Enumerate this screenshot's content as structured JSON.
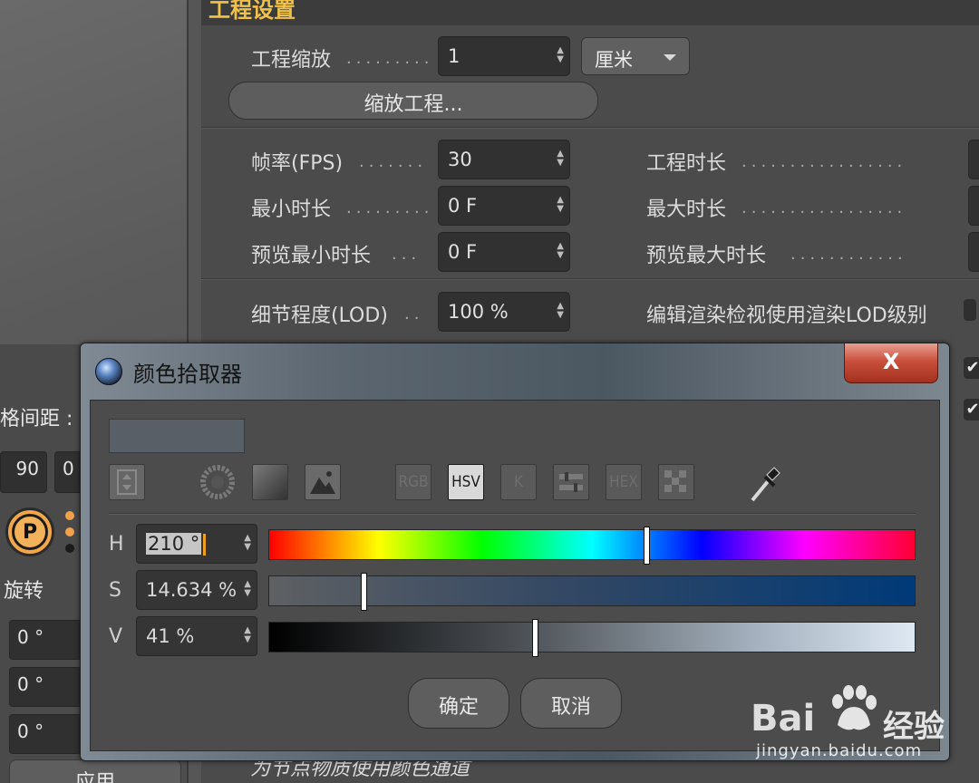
{
  "panel": {
    "title": "工程设置",
    "scale": {
      "label": "工程缩放",
      "value": "1",
      "unit": "厘米"
    },
    "scale_button": "缩放工程...",
    "fps": {
      "label": "帧率(FPS)",
      "value": "30"
    },
    "min_time": {
      "label": "最小时长",
      "value": "0 F"
    },
    "preview_min": {
      "label": "预览最小时长",
      "value": "0 F"
    },
    "project_length": {
      "label": "工程时长"
    },
    "max_time": {
      "label": "最大时长"
    },
    "preview_max": {
      "label": "预览最大时长"
    },
    "lod": {
      "label": "细节程度(LOD)",
      "value": "100 %"
    },
    "render_lod": {
      "label": "编辑渲染检视使用渲染LOD级别"
    },
    "checkmarks": [
      "✔",
      "✔"
    ],
    "bottom_text": "为节点物质使用颜色通道"
  },
  "left_panel": {
    "spacing_label": "格间距 :",
    "field_a": "90",
    "field_b": "0",
    "badge": "P",
    "rotate_label": "旋转",
    "rotation_fields": [
      "0 °",
      "0 °",
      "0 °"
    ],
    "apply_label": "应用"
  },
  "dialog": {
    "title": "颜色拾取器",
    "close_label": "X",
    "swatch_color": "#595f66",
    "mode_tabs": [
      "RGB",
      "HSV",
      "K",
      "",
      "HEX",
      ""
    ],
    "active_tab": "HSV",
    "channels": {
      "h": {
        "label": "H",
        "value": "210",
        "unit": "°",
        "fraction": 0.583
      },
      "s": {
        "label": "S",
        "value": "14.634 %",
        "fraction": 0.146
      },
      "v": {
        "label": "V",
        "value": "41 %",
        "fraction": 0.41
      }
    },
    "ok_label": "确定",
    "cancel_label": "取消"
  },
  "watermark": {
    "brand": "Bai",
    "brand_cn": "经验",
    "url": "jingyan.baidu.com"
  }
}
